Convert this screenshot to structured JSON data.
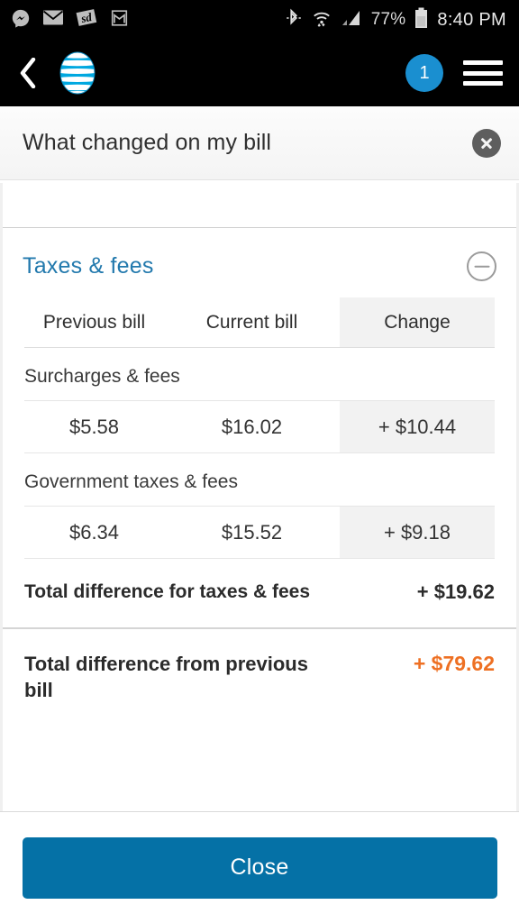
{
  "status_bar": {
    "left_icons": [
      "messenger-icon",
      "email-icon",
      "slickdeals-icon",
      "gmail-icon"
    ],
    "right_icons": [
      "bluetooth-icon",
      "wifi-icon",
      "cell-signal-icon"
    ],
    "battery_percent": "77%",
    "clock": "8:40 PM"
  },
  "app_bar": {
    "back_icon": "back-chevron-icon",
    "logo": "att-globe-logo",
    "notification_count": "1",
    "menu_icon": "hamburger-menu-icon"
  },
  "modal": {
    "title": "What changed on my bill",
    "close_icon": "close-circle-icon"
  },
  "section": {
    "title": "Taxes & fees",
    "collapse_icon": "minus-circle-icon",
    "columns": [
      "Previous bill",
      "Current bill",
      "Change"
    ],
    "rows": [
      {
        "label": "Surcharges & fees",
        "previous": "$5.58",
        "current": "$16.02",
        "change": "+ $10.44"
      },
      {
        "label": "Government taxes & fees",
        "previous": "$6.34",
        "current": "$15.52",
        "change": "+ $9.18"
      }
    ],
    "subtotal_label": "Total difference for taxes & fees",
    "subtotal_value": "+ $19.62"
  },
  "grand_total": {
    "label": "Total difference from previous bill",
    "value": "+ $79.62"
  },
  "footer": {
    "close_label": "Close"
  },
  "colors": {
    "accent_blue": "#0571a6",
    "link_blue": "#2279ad",
    "orange": "#ee7023",
    "badge_blue": "#1a8fd0"
  }
}
